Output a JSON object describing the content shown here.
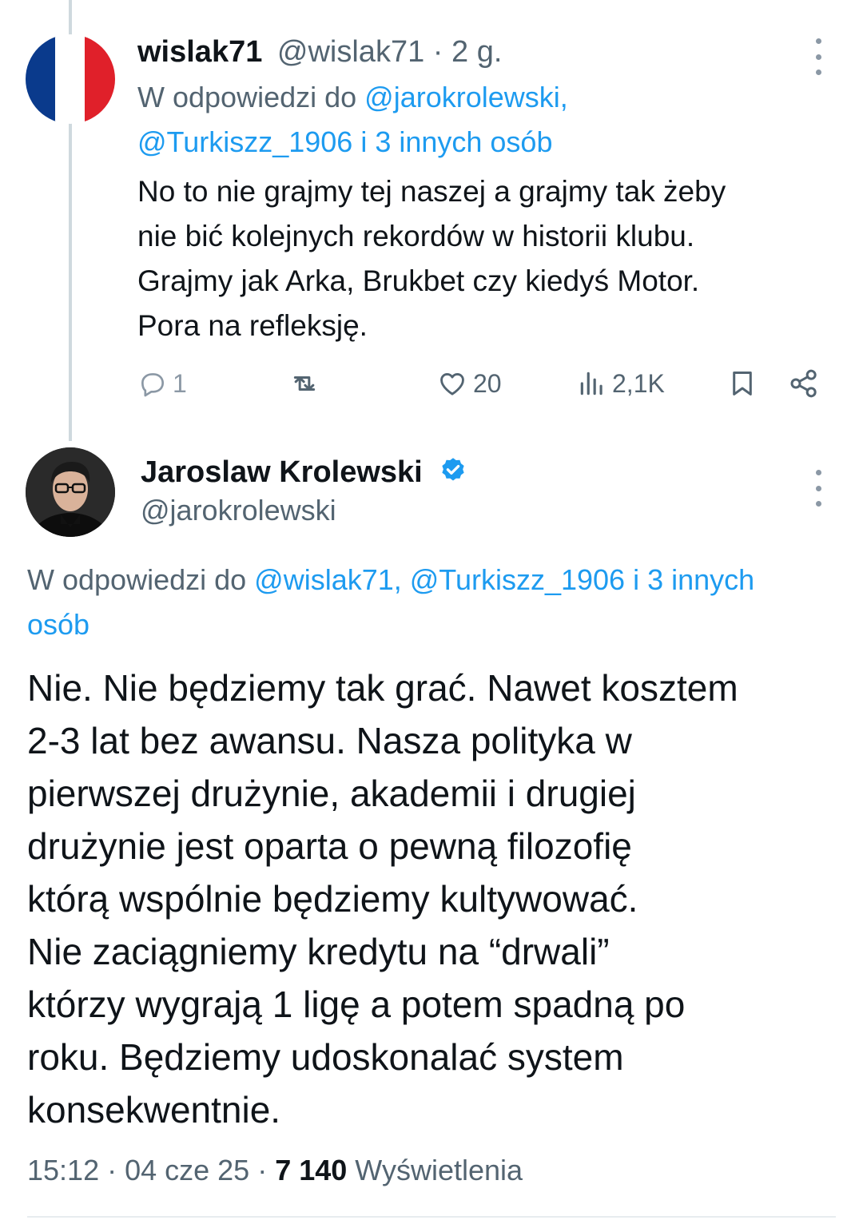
{
  "reply_tweet": {
    "name": "wislak71",
    "handle": "@wislak71",
    "separator": " · ",
    "time": "2 g.",
    "reply_prefix": "W odpowiedzi do ",
    "reply_line1_links": "@jarokrolewski,",
    "reply_line2_links": "@Turkiszz_1906 i 3 innych osób",
    "text_lines": [
      "No to nie grajmy tej naszej a grajmy tak żeby",
      "nie bić kolejnych rekordów w historii klubu.",
      "Grajmy jak Arka, Brukbet czy kiedyś Motor.",
      "Pora na refleksję."
    ],
    "actions": {
      "replies": "1",
      "retweets": "",
      "likes": "20",
      "views": "2,1K"
    }
  },
  "main_tweet": {
    "name": "Jaroslaw Krolewski",
    "handle": "@jarokrolewski",
    "reply_prefix": "W odpowiedzi do ",
    "reply_line1_links": "@wislak71, @Turkiszz_1906 i 3 innych",
    "reply_line2_links": "osób",
    "text_lines": [
      "Nie. Nie będziemy tak grać. Nawet kosztem",
      "2-3 lat bez awansu. Nasza polityka w",
      "pierwszej drużynie, akademii i drugiej",
      "drużynie jest oparta o pewną filozofię",
      "którą wspólnie będziemy kultywować.",
      "Nie zaciągniemy kredytu na “drwali”",
      "którzy wygrają 1 ligę a potem spadną po",
      "roku. Będziemy udoskonalać system",
      "konsekwentnie."
    ],
    "timestamp": "15:12 · 04 cze 25 · ",
    "view_count": "7 140",
    "views_label": " Wyświetlenia"
  },
  "colors": {
    "link": "#1d9bf0",
    "secondary_text": "#536471",
    "verified": "#1d9bf0"
  },
  "icons": {
    "reply": "reply-icon",
    "retweet": "retweet-icon",
    "like": "heart-icon",
    "views": "views-icon",
    "bookmark": "bookmark-icon",
    "share": "share-icon",
    "more": "more-icon",
    "verified": "verified-badge-icon"
  }
}
